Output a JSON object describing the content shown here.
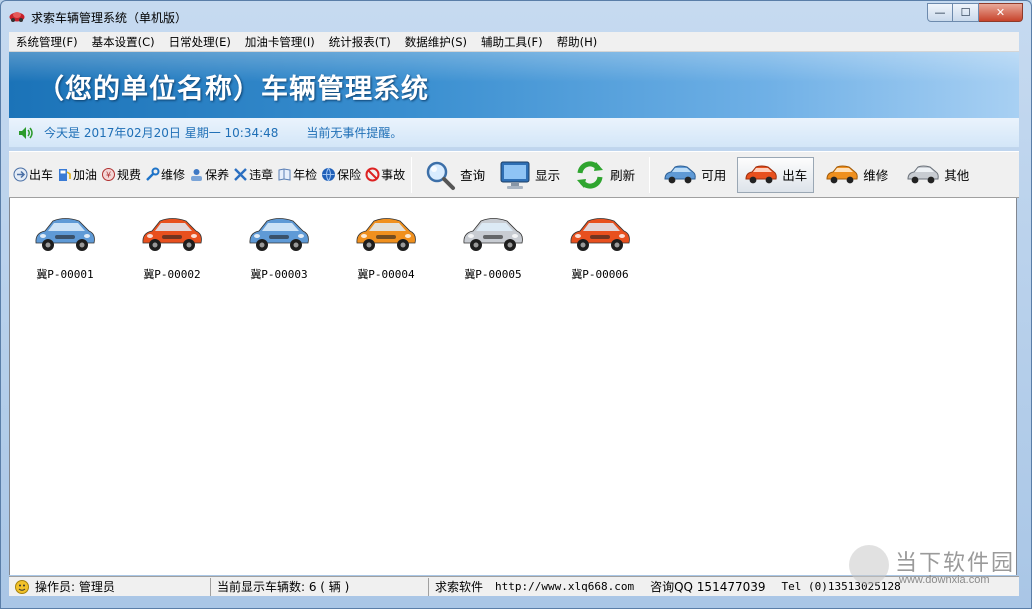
{
  "window": {
    "title": "求索车辆管理系统（单机版）",
    "controls": {
      "minimize": "—",
      "maximize": "☐",
      "close": "✕"
    }
  },
  "menu": [
    "系统管理(F)",
    "基本设置(C)",
    "日常处理(E)",
    "加油卡管理(I)",
    "统计报表(T)",
    "数据维护(S)",
    "辅助工具(F)",
    "帮助(H)"
  ],
  "banner": {
    "title": "（您的单位名称）车辆管理系统"
  },
  "infobar": {
    "date_text": "今天是 2017年02月20日 星期一 10:34:48",
    "event_text": "当前无事件提醒。"
  },
  "toolbar": {
    "small": [
      {
        "label": "出车",
        "icon": "dispatch-icon"
      },
      {
        "label": "加油",
        "icon": "fuel-icon"
      },
      {
        "label": "规费",
        "icon": "fee-icon"
      },
      {
        "label": "维修",
        "icon": "repair-icon"
      },
      {
        "label": "保养",
        "icon": "maintenance-icon"
      },
      {
        "label": "违章",
        "icon": "violation-icon"
      },
      {
        "label": "年检",
        "icon": "inspection-icon"
      },
      {
        "label": "保险",
        "icon": "insurance-icon"
      },
      {
        "label": "事故",
        "icon": "accident-icon"
      }
    ],
    "big": [
      {
        "label": "查询",
        "icon": "magnifier-icon"
      },
      {
        "label": "显示",
        "icon": "monitor-icon"
      },
      {
        "label": "刷新",
        "icon": "refresh-icon"
      }
    ],
    "filters": [
      {
        "label": "可用",
        "icon": "car-blue-icon",
        "active": false
      },
      {
        "label": "出车",
        "icon": "car-red-icon",
        "active": true
      },
      {
        "label": "维修",
        "icon": "car-orange-icon",
        "active": false
      },
      {
        "label": "其他",
        "icon": "car-silver-icon",
        "active": false
      }
    ]
  },
  "vehicles": [
    {
      "plate": "冀P-00001",
      "color": "#5f9ad6"
    },
    {
      "plate": "冀P-00002",
      "color": "#e8501e"
    },
    {
      "plate": "冀P-00003",
      "color": "#5f9ad6"
    },
    {
      "plate": "冀P-00004",
      "color": "#f0901e"
    },
    {
      "plate": "冀P-00005",
      "color": "#c8ccd2"
    },
    {
      "plate": "冀P-00006",
      "color": "#e8501e"
    }
  ],
  "status": {
    "operator": "操作员: 管理员",
    "count": "当前显示车辆数: 6 ( 辆 )",
    "company": "求索软件",
    "url": "http://www.xlq668.com",
    "qq": "咨询QQ 151477039",
    "tel": "Tel (0)13513025128"
  },
  "watermark": {
    "text": "当下软件园",
    "url": "www.downxia.com"
  },
  "colors": {
    "banner_start": "#1b73b8",
    "banner_end": "#a8d0f3",
    "info_text": "#1f6fb6"
  }
}
